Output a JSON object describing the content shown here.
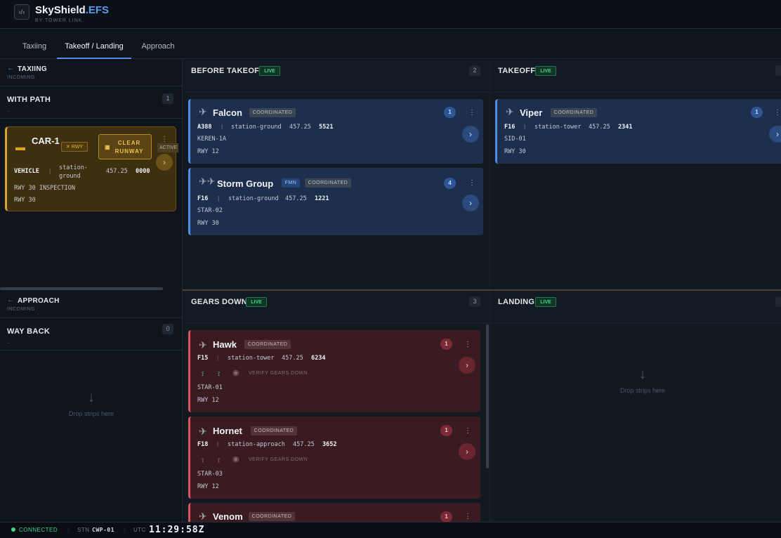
{
  "app": {
    "logo_glyph": "‹/›",
    "name_main": "SkyShield",
    "name_accent": ".EFS",
    "sub": "BY TOWER LINK"
  },
  "tabs": [
    {
      "label": "Taxiing"
    },
    {
      "label": "Takeoff / Landing"
    },
    {
      "label": "Approach"
    }
  ],
  "left": {
    "taxiing": {
      "title": "TAXIING",
      "sub": "INCOMING"
    },
    "with_path": {
      "title": "WITH PATH",
      "count": "1",
      "dash": "-"
    },
    "car": {
      "name": "CAR-1",
      "badge": "✕ RWY",
      "clear_label": "CLEAR RUNWAY",
      "status": "ACTIVE",
      "type": "VEHICLE",
      "station": "station-ground",
      "freq": "457.25",
      "code": "0000",
      "note": "RWY 30 INSPECTION",
      "runway": "RWY 30"
    },
    "approach": {
      "title": "APPROACH",
      "sub": "INCOMING"
    },
    "way_back": {
      "title": "WAY BACK",
      "count": "0",
      "dash": "-"
    },
    "drop": "Drop strips here"
  },
  "columns": {
    "before_takeoff": {
      "title": "BEFORE TAKEOFF",
      "live": "LIVE",
      "count": "2"
    },
    "takeoff": {
      "title": "TAKEOFF",
      "live": "LIVE"
    },
    "gears_down": {
      "title": "GEARS DOWN",
      "live": "LIVE",
      "count": "3"
    },
    "landing": {
      "title": "LANDING",
      "live": "LIVE",
      "drop": "Drop strips here"
    }
  },
  "strips": {
    "falcon": {
      "name": "Falcon",
      "status": "COORDINATED",
      "num": "1",
      "type": "A388",
      "station": "station-ground",
      "freq": "457.25",
      "code": "5521",
      "route": "KEREN-1A",
      "runway": "RWY 12"
    },
    "storm": {
      "name": "Storm Group",
      "fmn": "FMN",
      "status": "COORDINATED",
      "num": "4",
      "type": "F16",
      "station": "station-ground",
      "freq": "457.25",
      "code": "1221",
      "route": "STAR-02",
      "runway": "RWY 30"
    },
    "viper": {
      "name": "Viper",
      "status": "COORDINATED",
      "num": "1",
      "type": "F16",
      "station": "station-tower",
      "freq": "457.25",
      "code": "2341",
      "route": "SID-01",
      "runway": "RWY 30"
    },
    "hawk": {
      "name": "Hawk",
      "status": "COORDINATED",
      "num": "1",
      "type": "F15",
      "station": "station-tower",
      "freq": "457.25",
      "code": "6234",
      "verify": "VERIFY GEARS DOWN",
      "route": "STAR-01",
      "runway": "RWY 12"
    },
    "hornet": {
      "name": "Hornet",
      "status": "COORDINATED",
      "num": "1",
      "type": "F18",
      "station": "station-approach",
      "freq": "457.25",
      "code": "3652",
      "verify": "VERIFY GEARS DOWN",
      "route": "STAR-03",
      "runway": "RWY 12"
    },
    "venom": {
      "name": "Venom",
      "status": "COORDINATED",
      "num": "1"
    }
  },
  "footer": {
    "connected": "CONNECTED",
    "stn_label": "STN",
    "stn_value": "CWP-01",
    "utc_label": "UTC",
    "utc_value": "11:29:58Z"
  },
  "colors": {
    "accent": "#4f8fe6",
    "live": "#3fd58a",
    "vehicle": "#d9a423",
    "alert": "#d95461"
  }
}
